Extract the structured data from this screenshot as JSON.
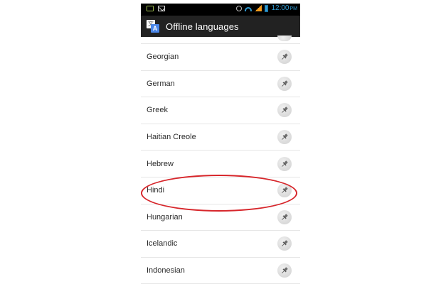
{
  "status_bar": {
    "time": "12:00",
    "meridiem": "PM",
    "icons": [
      "sim-icon",
      "mail-icon",
      "alarm-icon",
      "wifi-icon",
      "signal-icon",
      "battery-icon"
    ],
    "time_color": "#2f9bd3"
  },
  "action_bar": {
    "title": "Offline languages",
    "icon": "translate-app-icon",
    "background": "#222222"
  },
  "languages": [
    {
      "label": "",
      "partial": true
    },
    {
      "label": "Georgian"
    },
    {
      "label": "German"
    },
    {
      "label": "Greek"
    },
    {
      "label": "Haitian Creole"
    },
    {
      "label": "Hebrew"
    },
    {
      "label": "Hindi",
      "highlighted": true
    },
    {
      "label": "Hungarian"
    },
    {
      "label": "Icelandic"
    },
    {
      "label": "Indonesian"
    }
  ],
  "pin_icon": "pin-icon",
  "annotation": {
    "shape": "ellipse",
    "color": "#d7262b",
    "target": "Hindi"
  }
}
